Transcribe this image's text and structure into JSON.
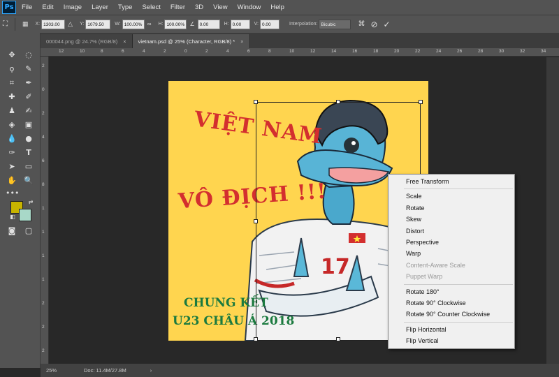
{
  "app": {
    "logo": "Ps"
  },
  "menu": [
    "File",
    "Edit",
    "Image",
    "Layer",
    "Type",
    "Select",
    "Filter",
    "3D",
    "View",
    "Window",
    "Help"
  ],
  "options": {
    "x_label": "X:",
    "x_value": "1303.00 px",
    "y_label": "Y:",
    "y_value": "1079.50 px",
    "w_label": "W:",
    "w_value": "100.00%",
    "h_label": "H:",
    "h_value": "100.00%",
    "angle_value": "0.00",
    "hskew_label": "H:",
    "hskew_value": "0.00",
    "vskew_label": "V:",
    "vskew_value": "0.00",
    "interp_label": "Interpolation:",
    "interp_value": "Bicubic"
  },
  "tabs": [
    {
      "label": "000044.png @ 24.7% (RGB/8)",
      "close": "×"
    },
    {
      "label": "vietnam.psd @ 25% (Character, RGB/8) *",
      "close": "×"
    }
  ],
  "ruler_top": [
    "12",
    "10",
    "8",
    "6",
    "4",
    "2",
    "0",
    "2",
    "4",
    "6",
    "8",
    "10",
    "12",
    "14",
    "16",
    "18",
    "20",
    "22",
    "24",
    "26",
    "28",
    "30",
    "32",
    "34"
  ],
  "ruler_left": [
    "2",
    "0",
    "2",
    "4",
    "6",
    "8",
    "1",
    "1",
    "1",
    "1",
    "2",
    "2",
    "2"
  ],
  "poster": {
    "line1": "VIỆT NAM",
    "line2": "VÔ ĐỊCH !!!",
    "line3": "CHUNG KẾT",
    "line4": "U23 CHÂU Á 2018"
  },
  "context_menu": {
    "free_transform": "Free Transform",
    "scale": "Scale",
    "rotate": "Rotate",
    "skew": "Skew",
    "distort": "Distort",
    "perspective": "Perspective",
    "warp": "Warp",
    "content_aware": "Content-Aware Scale",
    "puppet_warp": "Puppet Warp",
    "rotate180": "Rotate 180°",
    "rotate90cw": "Rotate 90° Clockwise",
    "rotate90ccw": "Rotate 90° Counter Clockwise",
    "flip_h": "Flip Horizontal",
    "flip_v": "Flip Vertical"
  },
  "status": {
    "zoom": "25%",
    "doc": "Doc: 11.4M/27.8M",
    "arrow": "›"
  },
  "colors": {
    "foreground": "#c8b400",
    "background": "#a8d8c8",
    "accent": "#31a8ff"
  }
}
